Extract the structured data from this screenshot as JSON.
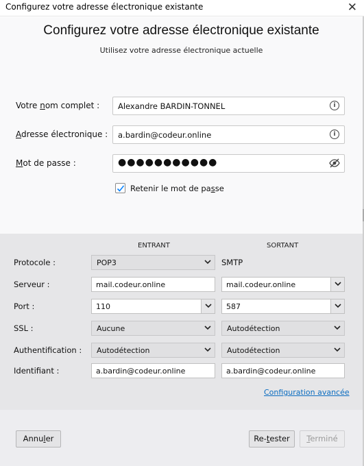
{
  "window": {
    "title": "Configurez votre adresse électronique existante",
    "close_glyph": "✕"
  },
  "header": {
    "title": "Configurez votre adresse électronique existante",
    "subtitle": "Utilisez votre adresse électronique actuelle"
  },
  "account": {
    "name_label_pre": "Votre ",
    "name_label_ul": "n",
    "name_label_post": "om complet :",
    "name_value": "Alexandre BARDIN-TONNEL",
    "email_label_ul": "A",
    "email_label_post": "dresse électronique :",
    "email_value": "a.bardin@codeur.online",
    "password_label_ul": "M",
    "password_label_post": "ot de passe :",
    "password_value": "●●●●●●●●●●●",
    "remember_label_pre": "Retenir le mot de pa",
    "remember_label_ul": "s",
    "remember_label_post": "se",
    "remember_checked": true
  },
  "server": {
    "incoming_header": "ENTRANT",
    "outgoing_header": "SORTANT",
    "rows": {
      "protocol": {
        "label": "Protocole :",
        "incoming": "POP3",
        "outgoing": "SMTP"
      },
      "server": {
        "label": "Serveur :",
        "incoming": "mail.codeur.online",
        "outgoing": "mail.codeur.online"
      },
      "port": {
        "label": "Port :",
        "incoming": "110",
        "outgoing": "587"
      },
      "ssl": {
        "label": "SSL :",
        "incoming": "Aucune",
        "outgoing": "Autodétection"
      },
      "auth": {
        "label": "Authentification :",
        "incoming": "Autodétection",
        "outgoing": "Autodétection"
      },
      "identifier": {
        "label": "Identifiant :",
        "incoming": "a.bardin@codeur.online",
        "outgoing": "a.bardin@codeur.online"
      }
    },
    "advanced_link": "Configuration avancée"
  },
  "footer": {
    "cancel_pre": "Annu",
    "cancel_ul": "l",
    "cancel_post": "er",
    "retest_pre": "Re-",
    "retest_ul": "t",
    "retest_post": "ester",
    "done_ul": "T",
    "done_post": "erminé"
  },
  "colors": {
    "link": "#0a6cc0",
    "checkbox_check": "#0a84ff"
  },
  "icons": [
    "info-icon",
    "eye-slash-icon",
    "chevron-down-icon",
    "checkmark-icon",
    "close-icon"
  ]
}
